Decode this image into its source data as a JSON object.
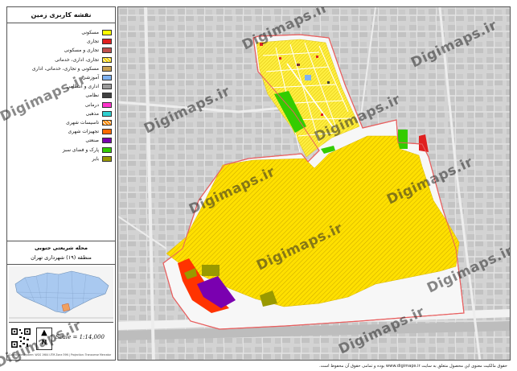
{
  "legend": {
    "title": "نقشه کاربری زمین",
    "items": [
      {
        "label": "مسکونی",
        "color": "#ffff00",
        "hatch": false
      },
      {
        "label": "تجاری",
        "color": "#e02020",
        "hatch": false
      },
      {
        "label": "تجاری و مسکونی",
        "color": "#c0504d",
        "hatch": false
      },
      {
        "label": "تجاری، اداری، خدماتی",
        "color": "#f0d000",
        "hatch": true
      },
      {
        "label": "مسکونی و تجاری، خدماتی، اداری",
        "color": "#c8a050",
        "hatch": false
      },
      {
        "label": "آموزشی",
        "color": "#7fb2f0",
        "hatch": false
      },
      {
        "label": "اداری و انتظامی",
        "color": "#9a9a9a",
        "hatch": false
      },
      {
        "label": "نظامی",
        "color": "#404040",
        "hatch": false
      },
      {
        "label": "درمانی",
        "color": "#ff33cc",
        "hatch": false
      },
      {
        "label": "مذهبی",
        "color": "#2fd0d0",
        "hatch": false
      },
      {
        "label": "تاسیسات شهری",
        "color": "#ff8800",
        "hatch": true
      },
      {
        "label": "تجهیزات شهری",
        "color": "#ff6a00",
        "hatch": false
      },
      {
        "label": "صنعتی",
        "color": "#7a00b0",
        "hatch": false
      },
      {
        "label": "پارک و فضای سبز",
        "color": "#33cc00",
        "hatch": false
      },
      {
        "label": "بایر",
        "color": "#999900",
        "hatch": false
      }
    ]
  },
  "region": {
    "line1": "محله شریعتی جنوبی",
    "line2": "منطقه (۱۹) شهرداری تهران"
  },
  "scale": {
    "text": "Scale = 1:14,000",
    "north_label": "N",
    "credits": "Coordinate System: WGS 1984 UTM Zone 39N  |  Projection: Transverse Mercator"
  },
  "watermark": "Digimaps.ir",
  "footer": "حقوق مالکیت معنوی این محصول متعلق به سایت www.digimaps.ir بوده و تمامی حقوق آن محفوظ است.",
  "colors": {
    "residential_hatch": "#f2d600",
    "residential_bg": "#ffe000",
    "boundary": "#e86060",
    "map_bg": "#d6d6d6"
  }
}
